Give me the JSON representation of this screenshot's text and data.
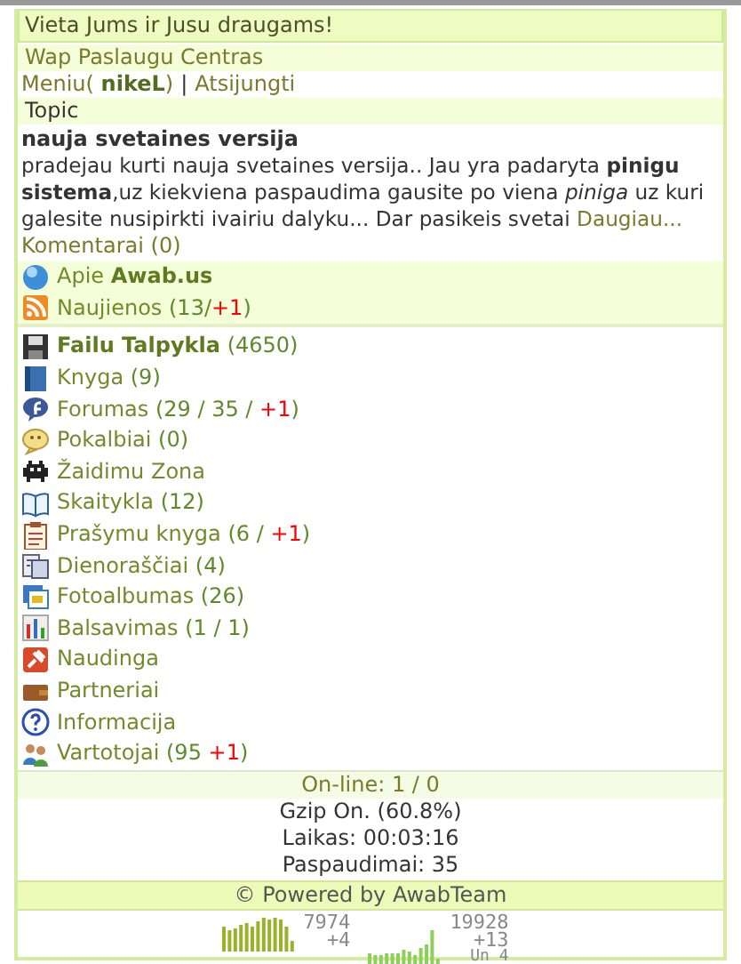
{
  "header": {
    "slogan": "Vieta Jums ir Jusu draugams!",
    "site": "Wap Paslaugu Centras"
  },
  "user_bar": {
    "menu_prefix": "Meniu( ",
    "username": "nikeL",
    "menu_suffix": ")",
    "separator": "|",
    "logout": "Atsijungti"
  },
  "news": {
    "section": "Topic",
    "title": "nauja svetaines versija",
    "body": "pradejau kurti nauja svetaines versija.. Jau yra padaryta **pinigu sistema**,uz kiekviena paspaudima gausite po viena *piniga* uz kuri galesite nusipirkti ivairiu dalyku... Dar pasikeis svetai",
    "more": "Daugiau...",
    "comments": "Komentarai (0)"
  },
  "featured": [
    {
      "kind": "globe",
      "parts": [
        {
          "text": "Apie ",
          "kind": "link"
        },
        {
          "text": "Awab.us",
          "kind": "bold"
        }
      ]
    },
    {
      "kind": "rss",
      "parts": [
        {
          "text": "Naujienos ",
          "kind": "link"
        },
        {
          "text": "(13/",
          "kind": "count"
        },
        {
          "text": "+1",
          "kind": "new"
        },
        {
          "text": ")",
          "kind": "count"
        }
      ]
    }
  ],
  "menu": [
    {
      "kind": "floppy",
      "parts": [
        {
          "text": "Failu Talpykla",
          "kind": "bold"
        },
        {
          "text": " (4650)",
          "kind": "count"
        }
      ]
    },
    {
      "kind": "book",
      "parts": [
        {
          "text": "Knyga ",
          "kind": "link"
        },
        {
          "text": "(9)",
          "kind": "count"
        }
      ]
    },
    {
      "kind": "forum",
      "parts": [
        {
          "text": "Forumas ",
          "kind": "link"
        },
        {
          "text": "(29 / 35 / ",
          "kind": "count"
        },
        {
          "text": "+1",
          "kind": "new"
        },
        {
          "text": ")",
          "kind": "count"
        }
      ]
    },
    {
      "kind": "chat",
      "parts": [
        {
          "text": "Pokalbiai ",
          "kind": "link"
        },
        {
          "text": "(0)",
          "kind": "count"
        }
      ]
    },
    {
      "kind": "invader",
      "parts": [
        {
          "text": "Žaidimu Zona",
          "kind": "link"
        }
      ]
    },
    {
      "kind": "openbook",
      "parts": [
        {
          "text": "Skaitykla ",
          "kind": "link"
        },
        {
          "text": "(12)",
          "kind": "count"
        }
      ]
    },
    {
      "kind": "clipboard",
      "parts": [
        {
          "text": "Prašymu knyga ",
          "kind": "link"
        },
        {
          "text": "(6 / ",
          "kind": "count"
        },
        {
          "text": "+1",
          "kind": "new"
        },
        {
          "text": ")",
          "kind": "count"
        }
      ]
    },
    {
      "kind": "notes",
      "parts": [
        {
          "text": "Dienoraščiai ",
          "kind": "link"
        },
        {
          "text": "(4)",
          "kind": "count"
        }
      ]
    },
    {
      "kind": "photos",
      "parts": [
        {
          "text": "Fotoalbumas ",
          "kind": "link"
        },
        {
          "text": "(26)",
          "kind": "count"
        }
      ]
    },
    {
      "kind": "barchart",
      "parts": [
        {
          "text": "Balsavimas ",
          "kind": "link"
        },
        {
          "text": "(1 / 1)",
          "kind": "count"
        }
      ]
    },
    {
      "kind": "pin",
      "parts": [
        {
          "text": "Naudinga",
          "kind": "link"
        }
      ]
    },
    {
      "kind": "wallet",
      "parts": [
        {
          "text": "Partneriai",
          "kind": "link"
        }
      ]
    },
    {
      "kind": "question",
      "parts": [
        {
          "text": "Informacija",
          "kind": "link"
        }
      ]
    },
    {
      "kind": "users",
      "parts": [
        {
          "text": "Vartotojai ",
          "kind": "link"
        },
        {
          "text": "(95 ",
          "kind": "count"
        },
        {
          "text": "+1",
          "kind": "new"
        },
        {
          "text": ")",
          "kind": "count"
        }
      ]
    }
  ],
  "footer": {
    "online": "On-line: 1 / 0",
    "stats": [
      "Gzip On. (60.8%)",
      "Laikas: 00:03:16",
      "Paspaudimai: 35"
    ],
    "powered": "© Powered by AwabTeam"
  },
  "counters": [
    {
      "total": "7974",
      "today": "+4"
    },
    {
      "total": "19928",
      "today": "+13",
      "extra": "Un 4"
    }
  ]
}
